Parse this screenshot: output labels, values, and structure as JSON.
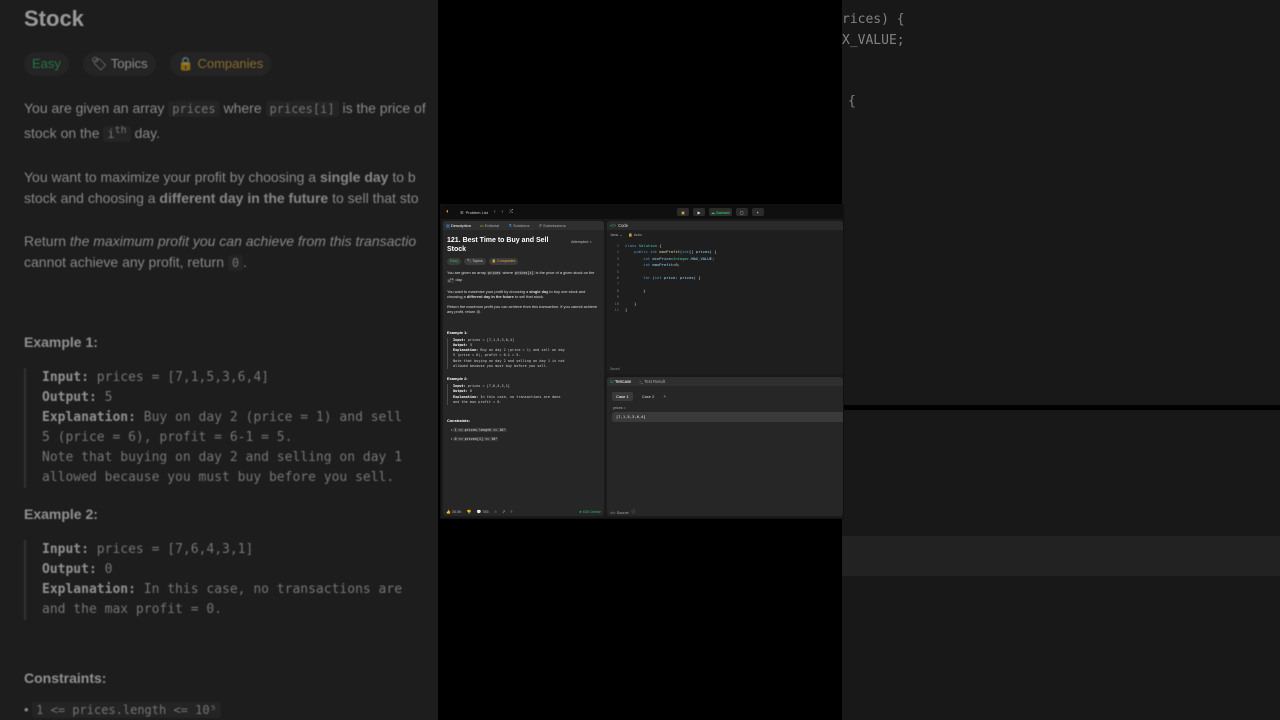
{
  "bg_left": {
    "title": "Stock",
    "tags": [
      "Easy",
      "Topics",
      "Companies"
    ],
    "p1_a": "You are given an array",
    "p1_code1": "prices",
    "p1_b": "where",
    "p1_code2": "prices[i]",
    "p1_c": "is the price of",
    "p1_d": "stock on the",
    "p1_code3": "i",
    "p1_sup": "th",
    "p1_e": "day.",
    "p2_a": "You want to maximize your profit by choosing a",
    "p2_b": "single day",
    "p2_c": "to b",
    "p2_d": "stock and choosing a",
    "p2_e": "different day in the future",
    "p2_f": "to sell that sto",
    "p3_a": "Return",
    "p3_b": "the maximum profit you can achieve from this transactio",
    "p3_c": "cannot achieve any profit, return",
    "p3_code": "0",
    "p3_d": ".",
    "ex1_title": "Example 1:",
    "ex1_input_label": "Input:",
    "ex1_input": "prices = [7,1,5,3,6,4]",
    "ex1_output_label": "Output:",
    "ex1_output": "5",
    "ex1_expl_label": "Explanation:",
    "ex1_expl1": "Buy on day 2 (price = 1) and sell",
    "ex1_expl2": "5 (price = 6), profit = 6-1 = 5.",
    "ex1_expl3": "Note that buying on day 2 and selling on day 1",
    "ex1_expl4": "allowed because you must buy before you sell.",
    "ex2_title": "Example 2:",
    "ex2_input_label": "Input:",
    "ex2_input": "prices = [7,6,4,3,1]",
    "ex2_output_label": "Output:",
    "ex2_output": "0",
    "ex2_expl_label": "Explanation:",
    "ex2_expl1": "In this case, no transactions are",
    "ex2_expl2": "and the max profit = 0.",
    "constraints_title": "Constraints:",
    "constraint1": "1 <= prices.length <= 10⁵"
  },
  "bg_right": {
    "line1": "rices) {",
    "line2": "X_VALUE;",
    "line3": "{"
  },
  "topbar": {
    "problem_list": "Problem List",
    "prev": "‹",
    "next": "›",
    "shuffle": "⤮",
    "submit": "Submit"
  },
  "tabs": {
    "description": "Description",
    "editorial": "Editorial",
    "solutions": "Solutions",
    "submissions": "Submissions"
  },
  "problem": {
    "title": "121. Best Time to Buy and Sell Stock",
    "status": "Attempted",
    "tag_easy": "Easy",
    "tag_topics": "Topics",
    "tag_companies": "Companies",
    "d1_a": "You are given an array",
    "d1_code1": "prices",
    "d1_b": "where",
    "d1_code2": "prices[i]",
    "d1_c": "is the price of a given stock on the",
    "d1_code3": "i",
    "d1_sup": "th",
    "d1_d": "day.",
    "d2_a": "You want to maximize your profit by choosing a",
    "d2_b": "single day",
    "d2_c": "to buy one stock and choosing a",
    "d2_d": "different day in the future",
    "d2_e": "to sell that stock.",
    "d3_a": "Return the maximum profit you can achieve from this transaction",
    "d3_b": ". If you cannot achieve any profit, return",
    "d3_code": "0",
    "d3_c": ".",
    "ex1_title": "Example 1:",
    "ex1_input": "prices = [7,1,5,3,6,4]",
    "ex1_output": "5",
    "ex1_expl1": "Buy on day 2 (price = 1) and sell on day",
    "ex1_expl2": "5 (price = 6), profit = 6-1 = 5.",
    "ex1_expl3": "Note that buying on day 2 and selling on day 1 is not",
    "ex1_expl4": "allowed because you must buy before you sell.",
    "ex2_title": "Example 2:",
    "ex2_input": "prices = [7,6,4,3,1]",
    "ex2_output": "0",
    "ex2_expl1": "In this case, no transactions are done",
    "ex2_expl2": "and the max profit = 0.",
    "input_label": "Input:",
    "output_label": "Output:",
    "expl_label": "Explanation:",
    "constraints_title": "Constraints:",
    "constraint1": "1 <= prices.length <= 10⁵",
    "constraint2": "0 <= prices[i] <= 10⁴"
  },
  "footer": {
    "likes": "35.5K",
    "comments": "785",
    "online": "630 Online"
  },
  "code": {
    "header": "Code",
    "language": "Java",
    "auto": "Auto",
    "saved": "Saved",
    "lines": [
      {
        "n": "1",
        "parts": [
          [
            "kw",
            "class "
          ],
          [
            "ty",
            "Solution"
          ],
          [
            "tx",
            " {"
          ]
        ]
      },
      {
        "n": "2",
        "parts": [
          [
            "tx",
            "    "
          ],
          [
            "kw",
            "public int "
          ],
          [
            "fn",
            "maxProfit"
          ],
          [
            "tx",
            "("
          ],
          [
            "kw",
            "int"
          ],
          [
            "tx",
            "[] "
          ],
          [
            "vr",
            "prices"
          ],
          [
            "tx",
            ") {"
          ]
        ]
      },
      {
        "n": "3",
        "parts": [
          [
            "tx",
            "        "
          ],
          [
            "kw",
            "int "
          ],
          [
            "vr",
            "minPrice"
          ],
          [
            "tx",
            "="
          ],
          [
            "ty",
            "Integer"
          ],
          [
            "tx",
            "."
          ],
          [
            "vr",
            "MAX_VALUE"
          ],
          [
            "tx",
            ";"
          ]
        ]
      },
      {
        "n": "4",
        "parts": [
          [
            "tx",
            "        "
          ],
          [
            "kw",
            "int "
          ],
          [
            "vr",
            "maxProfit"
          ],
          [
            "tx",
            "=0;"
          ]
        ]
      },
      {
        "n": "5",
        "parts": [
          [
            "tx",
            ""
          ]
        ]
      },
      {
        "n": "6",
        "parts": [
          [
            "tx",
            "        "
          ],
          [
            "kw",
            "for "
          ],
          [
            "tx",
            "("
          ],
          [
            "kw",
            "int "
          ],
          [
            "vr",
            "price"
          ],
          [
            "tx",
            ": "
          ],
          [
            "vr",
            "prices"
          ],
          [
            "tx",
            ") {"
          ]
        ]
      },
      {
        "n": "7",
        "parts": [
          [
            "tx",
            ""
          ]
        ]
      },
      {
        "n": "8",
        "parts": [
          [
            "tx",
            "        }"
          ]
        ]
      },
      {
        "n": "9",
        "parts": [
          [
            "tx",
            ""
          ]
        ]
      },
      {
        "n": "10",
        "parts": [
          [
            "tx",
            "    }"
          ]
        ]
      },
      {
        "n": "11",
        "parts": [
          [
            "tx",
            "}"
          ]
        ]
      }
    ]
  },
  "testcase": {
    "tab_testcase": "Testcase",
    "tab_result": "Test Result",
    "case1": "Case 1",
    "case2": "Case 2",
    "plus": "+",
    "input_label": "prices =",
    "input_value": "[7,1,5,3,6,4]",
    "source": "Source"
  },
  "colors": {
    "accent_green": "#2cbb5d",
    "accent_orange": "#e3a73b"
  }
}
